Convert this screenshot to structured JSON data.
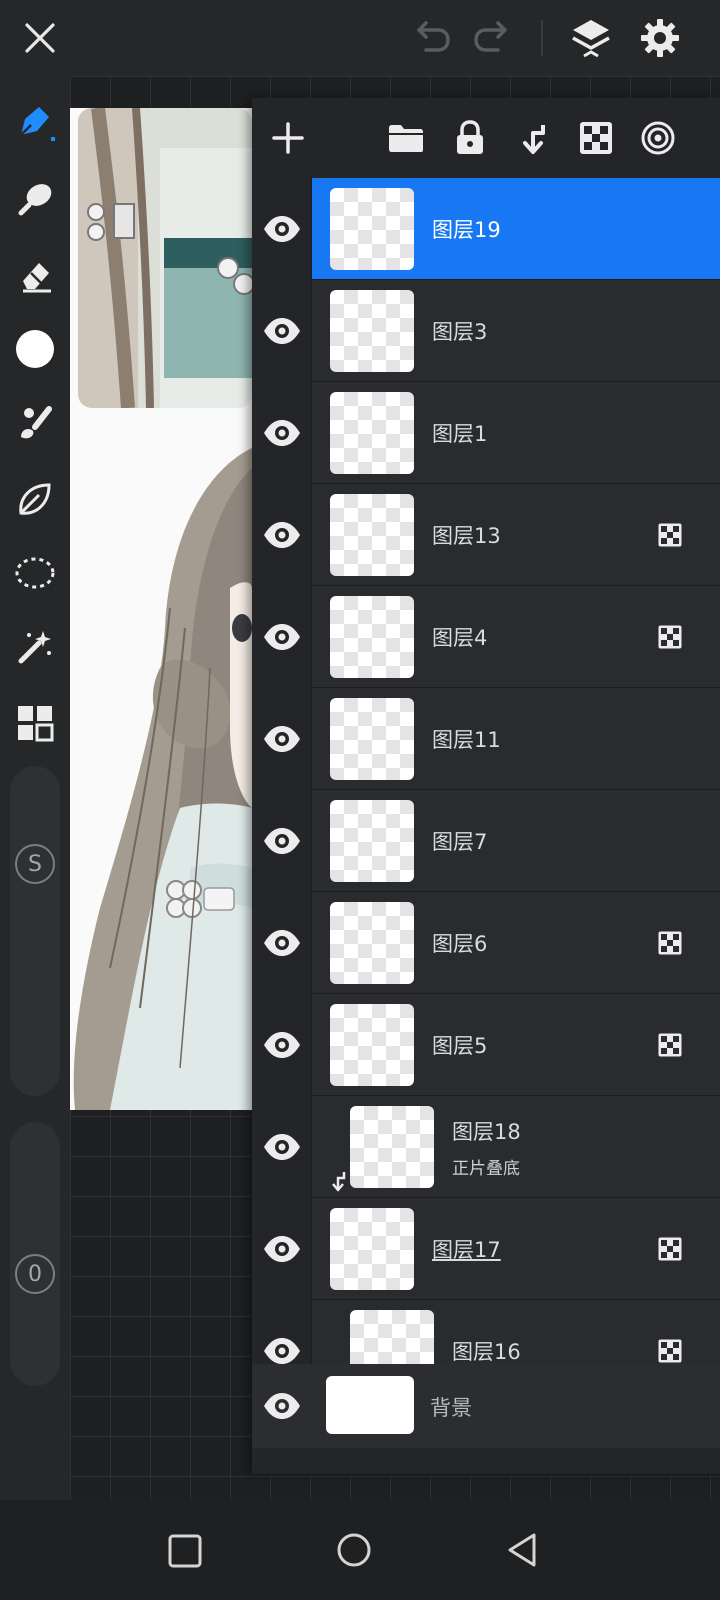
{
  "layers": [
    {
      "name": "图层19",
      "selected": true,
      "alpha_lock": false,
      "indent": false,
      "underline": false
    },
    {
      "name": "图层3",
      "selected": false,
      "alpha_lock": false,
      "indent": false,
      "underline": false
    },
    {
      "name": "图层1",
      "selected": false,
      "alpha_lock": false,
      "indent": false,
      "underline": false
    },
    {
      "name": "图层13",
      "selected": false,
      "alpha_lock": true,
      "indent": false,
      "underline": false
    },
    {
      "name": "图层4",
      "selected": false,
      "alpha_lock": true,
      "indent": false,
      "underline": false
    },
    {
      "name": "图层11",
      "selected": false,
      "alpha_lock": false,
      "indent": false,
      "underline": false
    },
    {
      "name": "图层7",
      "selected": false,
      "alpha_lock": false,
      "indent": false,
      "underline": false
    },
    {
      "name": "图层6",
      "selected": false,
      "alpha_lock": true,
      "indent": false,
      "underline": false
    },
    {
      "name": "图层5",
      "selected": false,
      "alpha_lock": true,
      "indent": false,
      "underline": false
    },
    {
      "name": "图层18",
      "mode": "正片叠底",
      "selected": false,
      "alpha_lock": false,
      "indent": true,
      "clipped": true,
      "underline": false
    },
    {
      "name": "图层17",
      "selected": false,
      "alpha_lock": true,
      "indent": false,
      "underline": true
    },
    {
      "name": "图层16",
      "selected": false,
      "alpha_lock": true,
      "indent": true,
      "underline": false
    }
  ],
  "background_layer": {
    "name": "背景"
  },
  "slider_values": {
    "size_label": "S",
    "opacity_value": "0"
  },
  "colors": {
    "accent": "#1877f2",
    "current_color": "#ffffff",
    "panel_bg": "#242528",
    "toolbar_bg": "#262729"
  },
  "toolbar_icons": [
    "brush-icon",
    "smudge-icon",
    "eraser-icon",
    "color-swatch",
    "paint-brush-icon",
    "leaf-icon",
    "lasso-icon",
    "magic-wand-icon",
    "gallery-icon"
  ],
  "nav_icons": [
    "recents-square-icon",
    "home-circle-icon",
    "back-triangle-icon"
  ]
}
